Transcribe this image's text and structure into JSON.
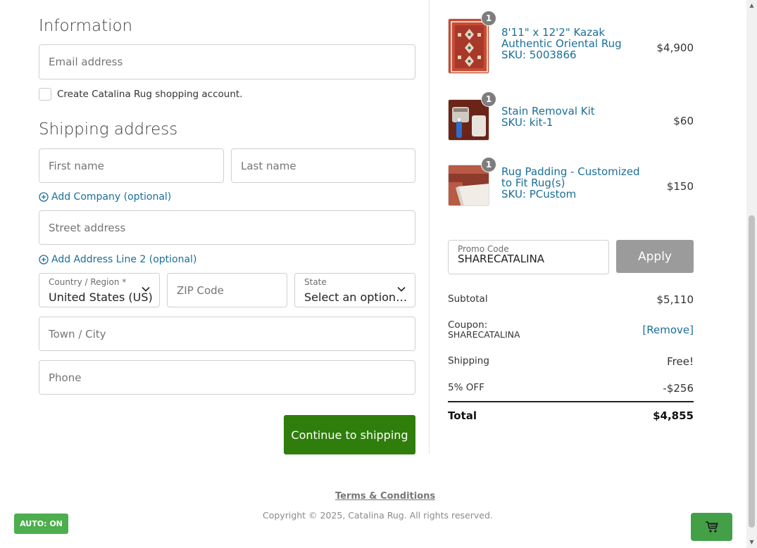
{
  "information": {
    "title": "Information",
    "email_placeholder": "Email address",
    "create_account_label": "Create Catalina Rug shopping account."
  },
  "shipping": {
    "title": "Shipping address",
    "first_name_placeholder": "First name",
    "last_name_placeholder": "Last name",
    "add_company_label": "Add Company (optional)",
    "street_placeholder": "Street address",
    "add_address_line2_label": "Add Address Line 2 (optional)",
    "country_label": "Country / Region *",
    "country_value": "United States (US)",
    "zip_placeholder": "ZIP Code",
    "state_label": "State",
    "state_value": "Select an option…",
    "city_placeholder": "Town / City",
    "phone_placeholder": "Phone",
    "continue_label": "Continue to shipping"
  },
  "cart": {
    "items": [
      {
        "name_line1": "8'11\" x 12'2\" Kazak",
        "name_line2": "Authentic Oriental Rug",
        "sku": "SKU: 5003866",
        "price": "$4,900",
        "qty": "1",
        "icon": "rug-thumbnail"
      },
      {
        "name_line1": "Stain Removal Kit",
        "name_line2": "",
        "sku": "SKU: kit-1",
        "price": "$60",
        "qty": "1",
        "icon": "kit-thumbnail"
      },
      {
        "name_line1": "Rug Padding - Customized",
        "name_line2": "to Fit Rug(s)",
        "sku": "SKU: PCustom",
        "price": "$150",
        "qty": "1",
        "icon": "padding-thumbnail"
      }
    ],
    "promo_label": "Promo Code",
    "promo_value": "SHARECATALINA",
    "apply_label": "Apply",
    "subtotal_label": "Subtotal",
    "subtotal_value": "$5,110",
    "coupon_label": "Coupon:",
    "coupon_code": "SHARECATALINA",
    "remove_label": "[Remove]",
    "shipping_label": "Shipping",
    "shipping_value": "Free!",
    "discount_label": "5% OFF",
    "discount_value": "-$256",
    "total_label": "Total",
    "total_value": "$4,855"
  },
  "footer": {
    "terms_label": "Terms & Conditions",
    "copyright": "Copyright © 2025, Catalina Rug. All rights reserved."
  },
  "widgets": {
    "auto_label": "AUTO: ON",
    "cart_icon": "cart-icon"
  },
  "colors": {
    "accent_green": "#2f7d0b",
    "link_blue": "#1a6f9a",
    "apply_gray": "#9b9b9b"
  }
}
